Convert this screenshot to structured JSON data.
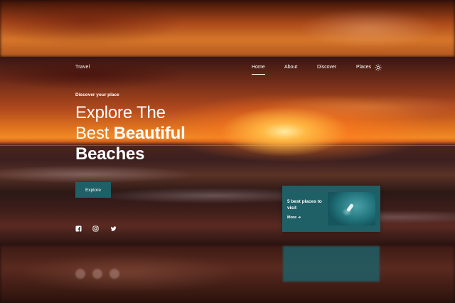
{
  "brand": "Travel",
  "nav": {
    "items": [
      "Home",
      "About",
      "Discover",
      "Places"
    ],
    "active": "Home",
    "theme_icon": "sun-icon"
  },
  "hero": {
    "eyebrow": "Discover your place",
    "headline_line1": "Explore The",
    "headline_line2_regular": "Best ",
    "headline_line2_bold": "Beautiful",
    "headline_line3_bold": "Beaches",
    "cta_label": "Explore"
  },
  "social": [
    "facebook-icon",
    "instagram-icon",
    "twitter-icon"
  ],
  "card": {
    "title": "5 best places to visit",
    "more_label": "More",
    "image": "boat-aerial-image"
  },
  "colors": {
    "accent": "#1f5f66",
    "text": "#ffffff"
  }
}
